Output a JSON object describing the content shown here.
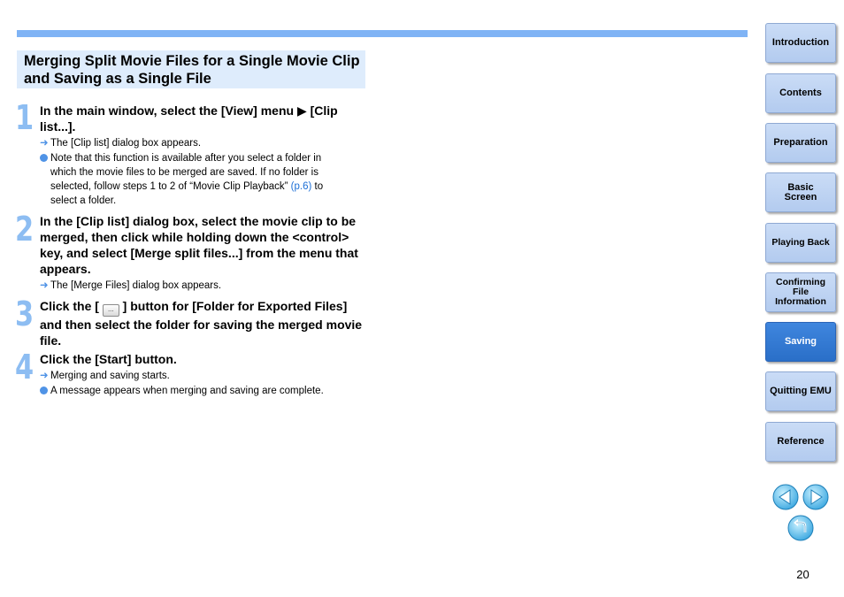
{
  "page_title": "Merging Split Movie Files for a Single Movie Clip and Saving as a Single File",
  "steps": [
    {
      "num": "1",
      "text": "In the main window, select the [View] menu ▶ [Clip list...].",
      "notes": [
        {
          "bullet": "arrow",
          "text": "The [Clip list] dialog box appears."
        },
        {
          "bullet": "dot",
          "text_before": "Note that this function is available after you select a folder in which the movie files to be merged are saved. If no folder is selected, follow steps 1 to 2 of “Movie Clip Playback” ",
          "link": "(p.6)",
          "text_after": " to select a folder."
        }
      ]
    },
    {
      "num": "2",
      "text": "In the [Clip list] dialog box, select the movie clip to be merged, then click while holding down the <control> key, and select [Merge split files...] from the menu that appears.",
      "notes": [
        {
          "bullet": "arrow",
          "text": "The [Merge Files] dialog box appears."
        }
      ]
    },
    {
      "num": "3",
      "text_before": "Click the [ ",
      "button_label": "...",
      "text_after": " ] button for [Folder for Exported Files] and then select the folder for saving the merged movie file.",
      "notes": []
    },
    {
      "num": "4",
      "text": "Click the [Start] button.",
      "notes": [
        {
          "bullet": "arrow",
          "text": "Merging and saving starts."
        },
        {
          "bullet": "dot",
          "text": "A message appears when merging and saving are complete."
        }
      ]
    }
  ],
  "nav": [
    {
      "label": "Introduction",
      "active": false
    },
    {
      "label": "Contents",
      "active": false
    },
    {
      "label": "Preparation",
      "active": false
    },
    {
      "label": "Basic Screen",
      "active": false
    },
    {
      "label": "Playing Back",
      "active": false
    },
    {
      "label": "Confirming File Information",
      "active": false
    },
    {
      "label": "Saving",
      "active": true
    },
    {
      "label": "Quitting EMU",
      "active": false
    },
    {
      "label": "Reference",
      "active": false
    }
  ],
  "page_number": "20",
  "colors": {
    "accent_bar": "#7fb3f5",
    "title_bg": "#deecfc",
    "step_number": "#8dbdf2",
    "link": "#1d6fd6",
    "nav_active": "#2a6fc8",
    "nav_inactive": "#b3cbef"
  },
  "icons": {
    "prev": "left-arrow-icon",
    "next": "right-arrow-icon",
    "back": "return-icon"
  }
}
